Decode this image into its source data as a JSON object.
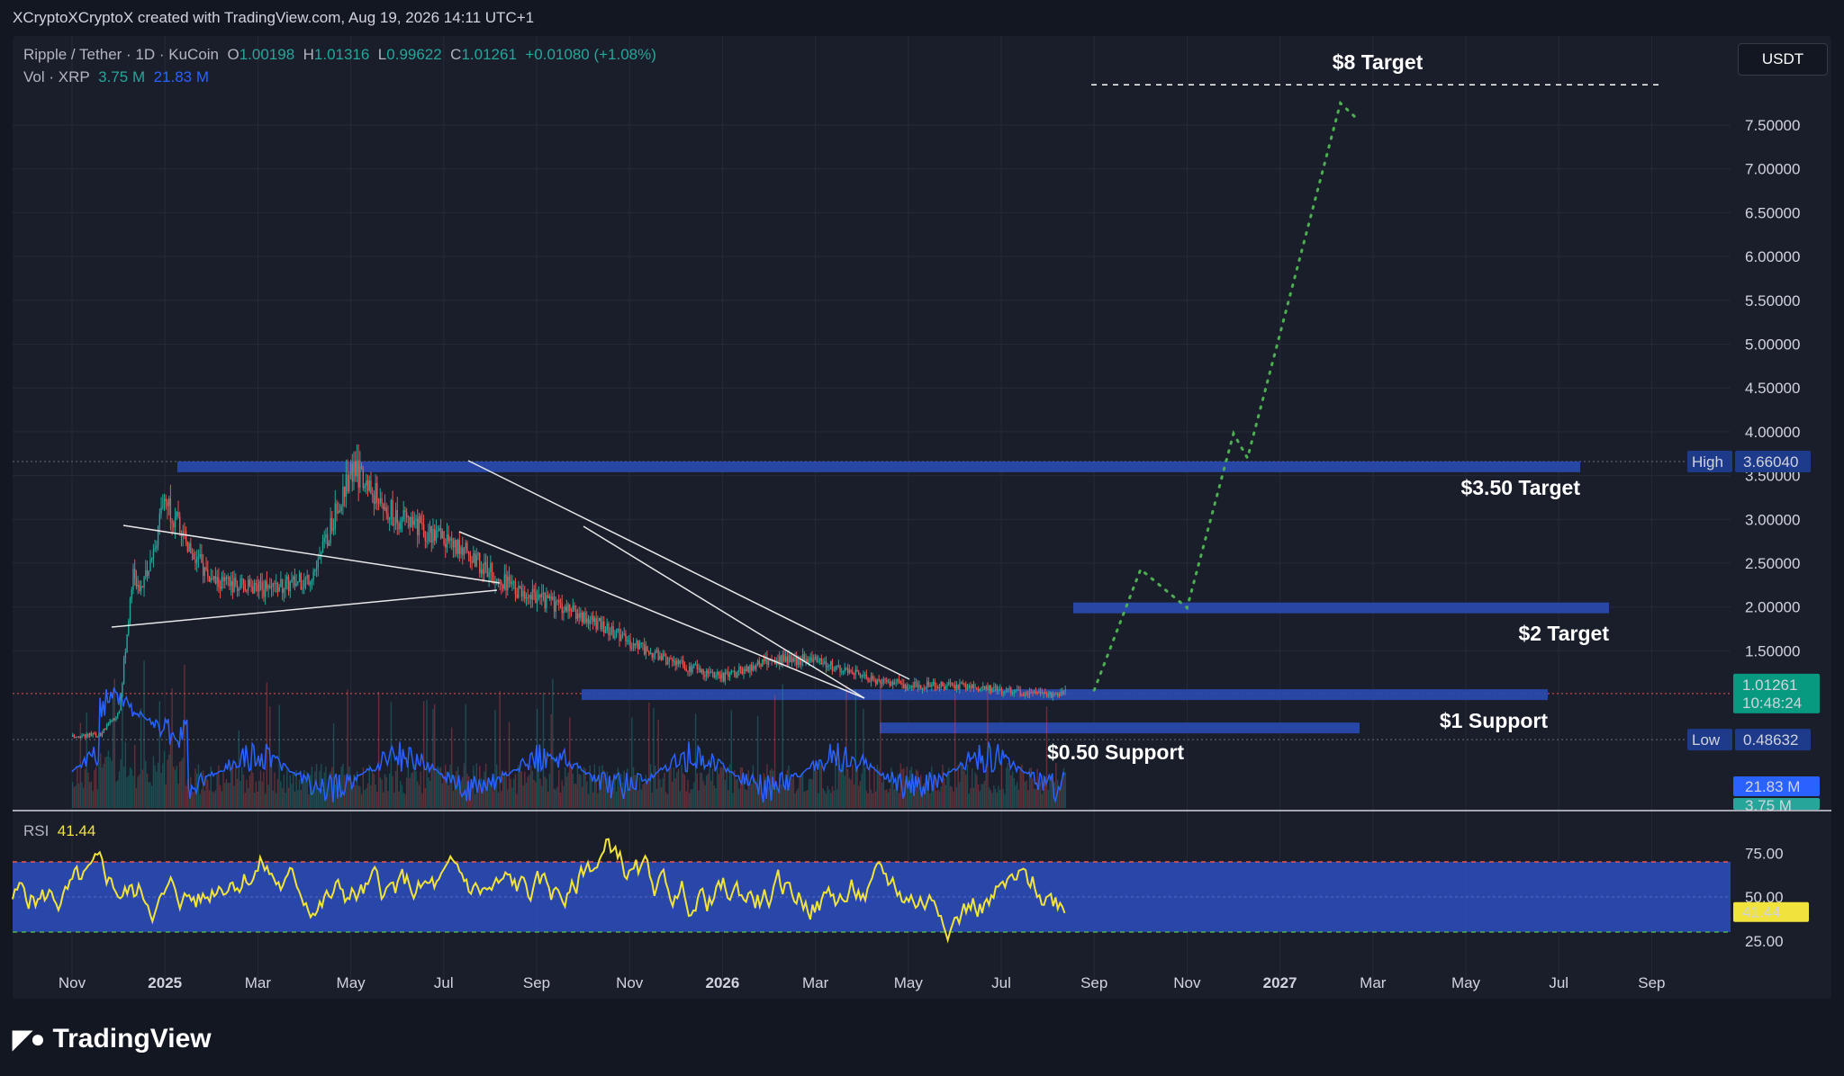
{
  "header": {
    "attribution": "XCryptoXCryptoX created with TradingView.com, Aug 19, 2026 14:11 UTC+1"
  },
  "legend": {
    "symbol": "Ripple / Tether · 1D · KuCoin",
    "o_label": "O",
    "o": "1.00198",
    "h_label": "H",
    "h": "1.01316",
    "l_label": "L",
    "l": "0.99622",
    "c_label": "C",
    "c": "1.01261",
    "change": "+0.01080 (+1.08%)",
    "vol_label": "Vol · XRP",
    "vol1": "3.75 M",
    "vol2": "21.83 M"
  },
  "currency": "USDT",
  "rsi_label": "RSI",
  "rsi_value": "41.44",
  "brand": "TradingView",
  "colors": {
    "bg": "#131722",
    "panel": "#1a1e2b",
    "zone": "#2a4ab0",
    "up": "#26a69a",
    "down": "#ef5350",
    "rsi": "#f1e33b",
    "projection": "#4caf50",
    "vol_ma": "#2962ff"
  },
  "chart_data": {
    "type": "candlestick",
    "symbol": "XRPUSDT",
    "timeframe": "1D",
    "ylim": [
      0.3,
      8.0
    ],
    "y_ticks": [
      "7.50000",
      "7.00000",
      "6.50000",
      "6.00000",
      "5.50000",
      "5.00000",
      "4.50000",
      "4.00000",
      "3.50000",
      "3.00000",
      "2.50000",
      "2.00000",
      "1.50000"
    ],
    "x_ticks": [
      {
        "label": "Nov",
        "bold": false
      },
      {
        "label": "2025",
        "bold": true
      },
      {
        "label": "Mar",
        "bold": false
      },
      {
        "label": "May",
        "bold": false
      },
      {
        "label": "Jul",
        "bold": false
      },
      {
        "label": "Sep",
        "bold": false
      },
      {
        "label": "Nov",
        "bold": false
      },
      {
        "label": "2026",
        "bold": true
      },
      {
        "label": "Mar",
        "bold": false
      },
      {
        "label": "May",
        "bold": false
      },
      {
        "label": "Jul",
        "bold": false
      },
      {
        "label": "Sep",
        "bold": false
      },
      {
        "label": "Nov",
        "bold": false
      },
      {
        "label": "2027",
        "bold": true
      },
      {
        "label": "Mar",
        "bold": false
      },
      {
        "label": "May",
        "bold": false
      },
      {
        "label": "Jul",
        "bold": false
      },
      {
        "label": "Sep",
        "bold": false
      }
    ],
    "price_path_months": [
      0,
      0.6,
      1,
      1.3,
      1.5,
      2,
      2.5,
      3,
      4,
      5,
      5.3,
      6,
      7,
      8,
      9,
      9.5,
      10,
      11,
      12,
      13,
      14,
      14.5,
      15,
      16,
      17,
      18,
      19,
      20,
      21,
      21.5
    ],
    "price_path_values": [
      0.52,
      0.55,
      0.8,
      2.4,
      2.2,
      3.2,
      2.7,
      2.3,
      2.2,
      2.3,
      2.5,
      3.6,
      3.0,
      2.8,
      2.4,
      2.2,
      2.1,
      1.9,
      1.6,
      1.35,
      1.2,
      1.3,
      1.4,
      1.4,
      1.2,
      1.1,
      1.1,
      1.05,
      1.01,
      1.01
    ],
    "high_label": "High",
    "high": "3.66040",
    "low_label": "Low",
    "low": "0.48632",
    "last_price": "1.01261",
    "countdown": "10:48:24",
    "vol_badges": [
      "21.83 M",
      "3.75 M"
    ],
    "zones": [
      {
        "label": "$3.50 Target",
        "price": 3.6
      },
      {
        "label": "$2 Target",
        "price": 1.99
      },
      {
        "label": "$1 Support",
        "price": 1.0
      },
      {
        "label": "$0.50 Support",
        "price": 0.62
      }
    ],
    "target_line": {
      "label": "$8 Target",
      "price": 7.96
    },
    "projection": [
      [
        22,
        1.05
      ],
      [
        23,
        2.43
      ],
      [
        24,
        1.99
      ],
      [
        25,
        3.98
      ],
      [
        25.3,
        3.7
      ],
      [
        27.3,
        7.75
      ],
      [
        27.6,
        7.6
      ]
    ],
    "rsi": {
      "ticks": [
        "75.00",
        "50.00",
        "25.00"
      ],
      "value": "41.44",
      "overbought": 70,
      "oversold": 30
    }
  }
}
